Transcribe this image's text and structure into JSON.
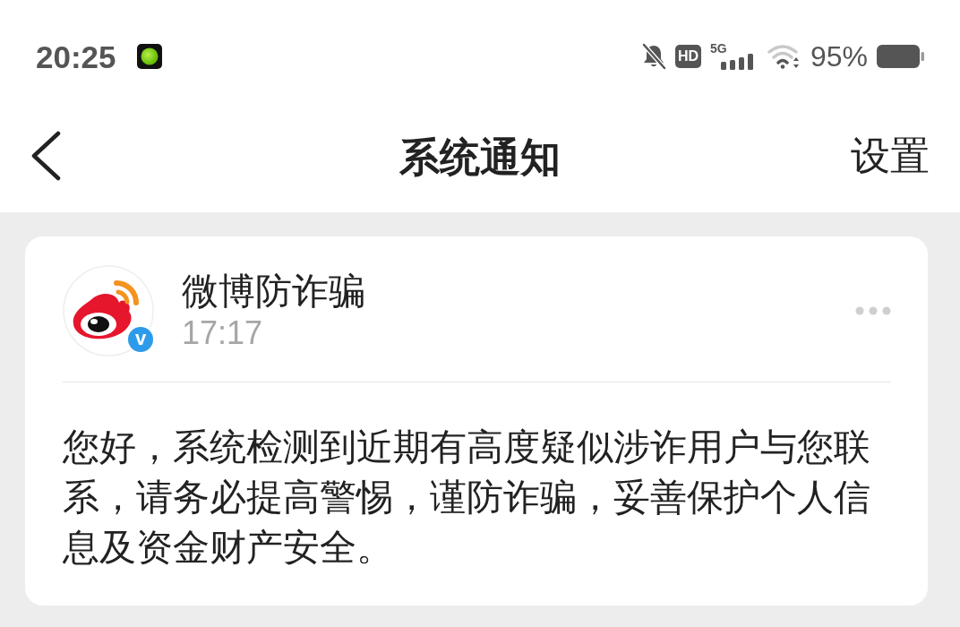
{
  "status_bar": {
    "time": "20:25",
    "hd_badge": "HD",
    "network": "5G",
    "battery": "95%"
  },
  "nav": {
    "title": "系统通知",
    "action": "设置"
  },
  "notification": {
    "sender": "微博防诈骗",
    "verified_badge": "v",
    "time": "17:17",
    "message": "您好，系统检测到近期有高度疑似涉诈用户与您联系，请务必提高警惕，谨防诈骗，妥善保护个人信息及资金财产安全。"
  }
}
